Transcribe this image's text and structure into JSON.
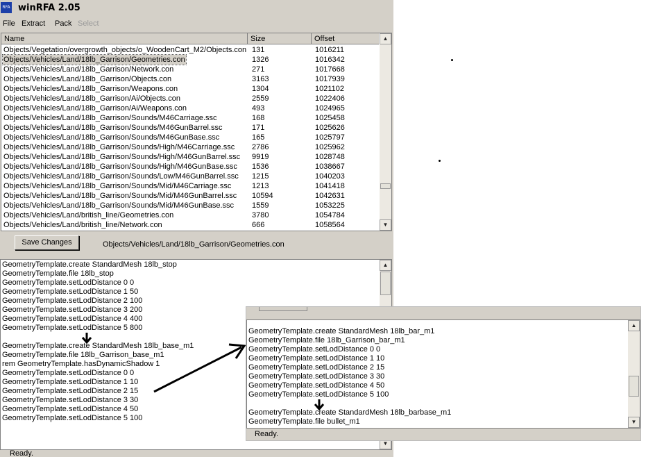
{
  "window": {
    "title": "winRFA 2.05",
    "icon_text": "RFA"
  },
  "menu": [
    {
      "label": "File",
      "enabled": true
    },
    {
      "label": "Extract",
      "enabled": true
    },
    {
      "label": "Pack",
      "enabled": true
    },
    {
      "label": "Select",
      "enabled": false
    }
  ],
  "file_list": {
    "columns": [
      "Name",
      "Size",
      "Offset"
    ],
    "selected_index": 1,
    "rows": [
      {
        "name": "Objects/Vegetation/overgrowth_objects/o_WoodenCart_M2/Objects.con",
        "size": "131",
        "offset": "1016211"
      },
      {
        "name": "Objects/Vehicles/Land/18lb_Garrison/Geometries.con",
        "size": "1326",
        "offset": "1016342"
      },
      {
        "name": "Objects/Vehicles/Land/18lb_Garrison/Network.con",
        "size": "271",
        "offset": "1017668"
      },
      {
        "name": "Objects/Vehicles/Land/18lb_Garrison/Objects.con",
        "size": "3163",
        "offset": "1017939"
      },
      {
        "name": "Objects/Vehicles/Land/18lb_Garrison/Weapons.con",
        "size": "1304",
        "offset": "1021102"
      },
      {
        "name": "Objects/Vehicles/Land/18lb_Garrison/Ai/Objects.con",
        "size": "2559",
        "offset": "1022406"
      },
      {
        "name": "Objects/Vehicles/Land/18lb_Garrison/Ai/Weapons.con",
        "size": "493",
        "offset": "1024965"
      },
      {
        "name": "Objects/Vehicles/Land/18lb_Garrison/Sounds/M46Carriage.ssc",
        "size": "168",
        "offset": "1025458"
      },
      {
        "name": "Objects/Vehicles/Land/18lb_Garrison/Sounds/M46GunBarrel.ssc",
        "size": "171",
        "offset": "1025626"
      },
      {
        "name": "Objects/Vehicles/Land/18lb_Garrison/Sounds/M46GunBase.ssc",
        "size": "165",
        "offset": "1025797"
      },
      {
        "name": "Objects/Vehicles/Land/18lb_Garrison/Sounds/High/M46Carriage.ssc",
        "size": "2786",
        "offset": "1025962"
      },
      {
        "name": "Objects/Vehicles/Land/18lb_Garrison/Sounds/High/M46GunBarrel.ssc",
        "size": "9919",
        "offset": "1028748"
      },
      {
        "name": "Objects/Vehicles/Land/18lb_Garrison/Sounds/High/M46GunBase.ssc",
        "size": "1536",
        "offset": "1038667"
      },
      {
        "name": "Objects/Vehicles/Land/18lb_Garrison/Sounds/Low/M46GunBarrel.ssc",
        "size": "1215",
        "offset": "1040203"
      },
      {
        "name": "Objects/Vehicles/Land/18lb_Garrison/Sounds/Mid/M46Carriage.ssc",
        "size": "1213",
        "offset": "1041418"
      },
      {
        "name": "Objects/Vehicles/Land/18lb_Garrison/Sounds/Mid/M46GunBarrel.ssc",
        "size": "10594",
        "offset": "1042631"
      },
      {
        "name": "Objects/Vehicles/Land/18lb_Garrison/Sounds/Mid/M46GunBase.ssc",
        "size": "1559",
        "offset": "1053225"
      },
      {
        "name": "Objects/Vehicles/Land/british_line/Geometries.con",
        "size": "3780",
        "offset": "1054784"
      },
      {
        "name": "Objects/Vehicles/Land/british_line/Network.con",
        "size": "666",
        "offset": "1058564"
      }
    ]
  },
  "toolbar": {
    "save_label": "Save Changes",
    "current_file": "Objects/Vehicles/Land/18lb_Garrison/Geometries.con"
  },
  "editor": {
    "lines": [
      "GeometryTemplate.create StandardMesh 18lb_stop",
      "GeometryTemplate.file 18lb_stop",
      "GeometryTemplate.setLodDistance 0 0",
      "GeometryTemplate.setLodDistance 1 50",
      "GeometryTemplate.setLodDistance 2 100",
      "GeometryTemplate.setLodDistance 3 200",
      "GeometryTemplate.setLodDistance 4 400",
      "GeometryTemplate.setLodDistance 5 800",
      "",
      "GeometryTemplate.create StandardMesh 18lb_base_m1",
      "GeometryTemplate.file 18lb_Garrison_base_m1",
      "rem GeometryTemplate.hasDynamicShadow 1",
      "GeometryTemplate.setLodDistance 0 0",
      "GeometryTemplate.setLodDistance 1 10",
      "GeometryTemplate.setLodDistance 2 15",
      "GeometryTemplate.setLodDistance 3 30",
      "GeometryTemplate.setLodDistance 4 50",
      "GeometryTemplate.setLodDistance 5 100"
    ]
  },
  "overlay_editor": {
    "lines": [
      "GeometryTemplate.create StandardMesh 18lb_bar_m1",
      "GeometryTemplate.file 18lb_Garrison_bar_m1",
      "GeometryTemplate.setLodDistance 0 0",
      "GeometryTemplate.setLodDistance 1 10",
      "GeometryTemplate.setLodDistance 2 15",
      "GeometryTemplate.setLodDistance 3 30",
      "GeometryTemplate.setLodDistance 4 50",
      "GeometryTemplate.setLodDistance 5 100",
      "",
      "GeometryTemplate.create StandardMesh 18lb_barbase_m1",
      "GeometryTemplate.file bullet_m1"
    ],
    "status": "Ready."
  },
  "status_bar": {
    "text": "Ready."
  },
  "icons": {
    "scroll_up": "up-arrow-icon",
    "scroll_down": "down-arrow-icon",
    "annotation_arrow": "arrow-icon"
  }
}
